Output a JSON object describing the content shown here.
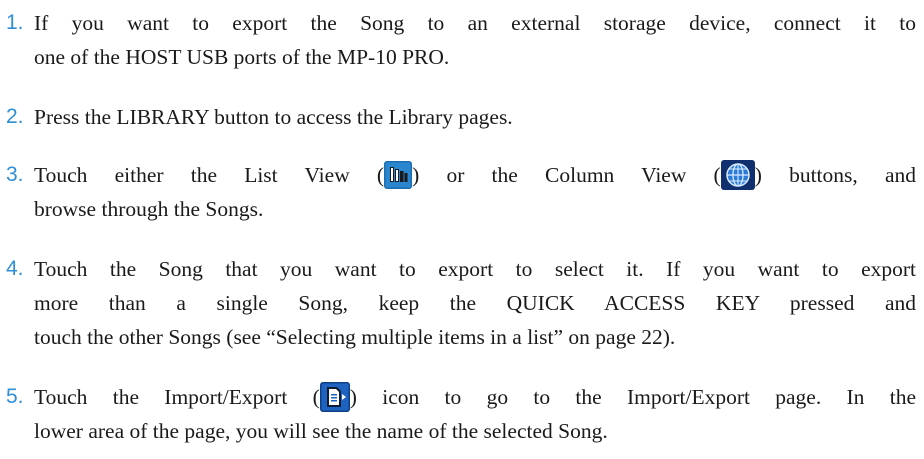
{
  "steps": [
    {
      "number": "1.",
      "lines": [
        "If you want to export the Song to an external storage device, connect it to",
        "one of the HOST USB ports of the MP-10 PRO."
      ]
    },
    {
      "number": "2.",
      "lines": [
        "Press the LIBRARY button to access the Library pages."
      ]
    },
    {
      "number": "3.",
      "line1_a": "Touch either the List View (",
      "line1_b": ") or the Column View (",
      "line1_c": ") buttons, and",
      "line2": "browse through the Songs.",
      "icons": [
        "list-view-icon",
        "column-view-icon"
      ]
    },
    {
      "number": "4.",
      "lines": [
        "Touch the Song that you want to export to select it. If you want to export",
        "more than a single Song, keep the QUICK ACCESS KEY pressed and",
        "touch the other Songs (see “Selecting multiple items in a list” on page 22)."
      ]
    },
    {
      "number": "5.",
      "line1_a": "Touch the Import/Export (",
      "line1_b": ") icon to go to the Import/Export page. In the",
      "line2": "lower area of the page, you will see the name of the selected Song.",
      "icons": [
        "import-export-icon"
      ]
    }
  ],
  "colors": {
    "number": "#2f8fd6",
    "text": "#1a1a1a"
  }
}
